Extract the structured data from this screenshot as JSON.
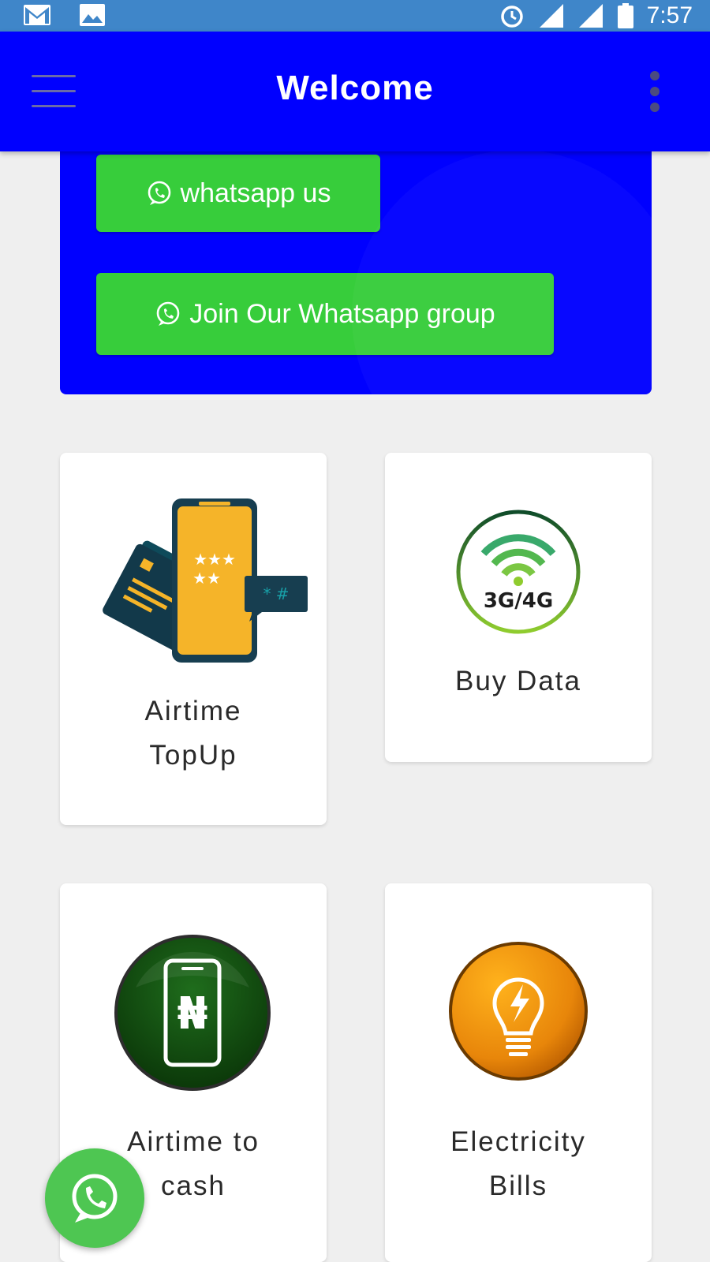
{
  "status_bar": {
    "time": "7:57",
    "left_icons": [
      "gmail-icon",
      "photos-icon"
    ],
    "right_icons": [
      "alarm-icon",
      "signal-icon",
      "signal-icon",
      "battery-icon"
    ]
  },
  "app_bar": {
    "title": "Welcome",
    "menu_icon": "hamburger-menu-icon",
    "overflow_icon": "more-vert-icon",
    "color": "#0000ff"
  },
  "banner": {
    "buttons": [
      {
        "label": "whatsapp us",
        "icon": "whatsapp-icon"
      },
      {
        "label": "Join Our Whatsapp group",
        "icon": "whatsapp-icon"
      }
    ],
    "button_color": "#37cd3b"
  },
  "services": [
    {
      "label_line1": "Airtime",
      "label_line2": "TopUp",
      "icon": "airtime-topup-icon"
    },
    {
      "label_line1": "Buy Data",
      "label_line2": "",
      "icon": "3g-4g-data-icon",
      "icon_text": "3G/4G"
    },
    {
      "label_line1": "Airtime to",
      "label_line2": "cash",
      "icon": "airtime-to-cash-icon",
      "icon_text": "₦"
    },
    {
      "label_line1": "Electricity",
      "label_line2": "Bills",
      "icon": "lightbulb-icon"
    }
  ],
  "fab": {
    "icon": "whatsapp-icon",
    "color": "#4ec652"
  }
}
